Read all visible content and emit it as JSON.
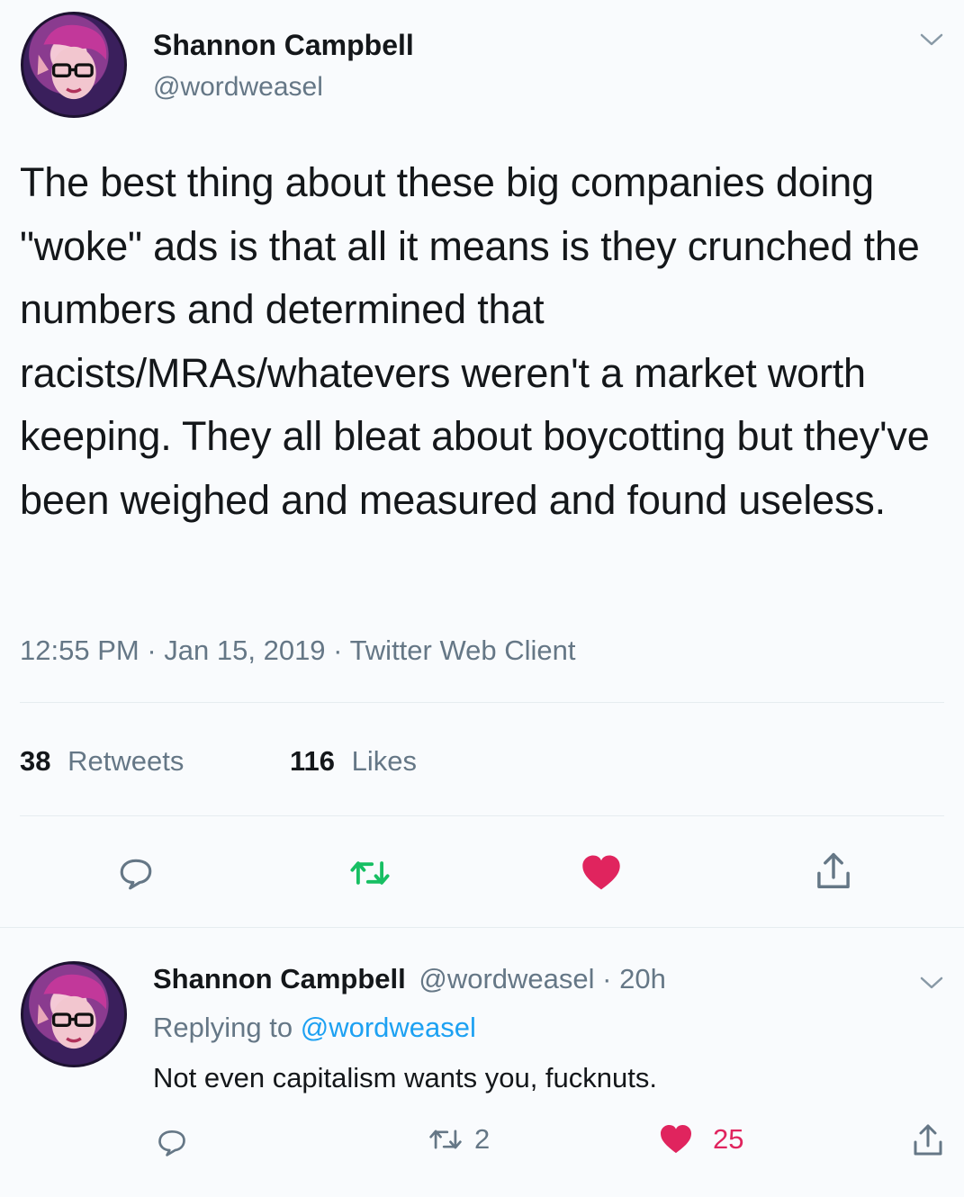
{
  "tweet": {
    "author_name": "Shannon Campbell",
    "author_handle": "@wordweasel",
    "text": "The best thing about these big companies doing \"woke\" ads is that all it means is they crunched the numbers and determined that racists/MRAs/whatevers weren't a market worth keeping. They all bleat about boycotting but they've been weighed and measured and found useless.",
    "time": "12:55 PM",
    "date": "Jan 15, 2019",
    "client": "Twitter Web Client",
    "separator": "·",
    "retweet_count": "38",
    "retweet_label": "Retweets",
    "like_count": "116",
    "like_label": "Likes",
    "icons": [
      "reply-icon",
      "retweet-icon",
      "heart-icon",
      "share-icon",
      "chevron-down-icon"
    ],
    "colors": {
      "retweet_active": "#17bf63",
      "like_active": "#e0245e",
      "link": "#1da1f2"
    }
  },
  "reply": {
    "author_name": "Shannon Campbell",
    "author_handle": "@wordweasel",
    "age": "20h",
    "separator": "·",
    "replying_prefix": "Replying to",
    "replying_handle": "@wordweasel",
    "text": "Not even capitalism wants you, fucknuts.",
    "retweet_count": "2",
    "like_count": "25"
  }
}
